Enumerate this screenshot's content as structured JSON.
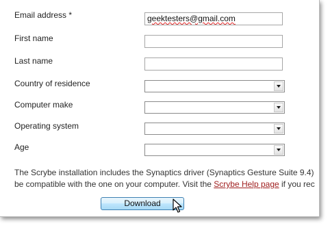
{
  "form": {
    "email": {
      "label": "Email address *",
      "value": "geektesters@gmail.com"
    },
    "first_name": {
      "label": "First name",
      "value": ""
    },
    "last_name": {
      "label": "Last name",
      "value": ""
    },
    "country": {
      "label": "Country of residence",
      "value": ""
    },
    "computer_make": {
      "label": "Computer make",
      "value": ""
    },
    "operating_system": {
      "label": "Operating system",
      "value": ""
    },
    "age": {
      "label": "Age",
      "value": ""
    }
  },
  "info": {
    "line1": "The Scrybe installation includes the Synaptics driver (Synaptics Gesture Suite 9.4)",
    "line2_prefix": "be compatible with the one on your computer. Visit the ",
    "link_text": "Scrybe Help page",
    "line2_suffix": " if you rec"
  },
  "download_button": {
    "label": "Download"
  }
}
